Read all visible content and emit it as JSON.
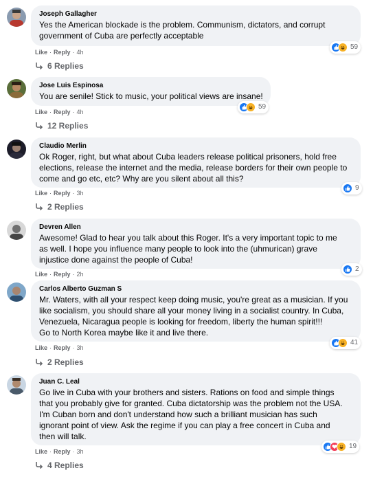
{
  "actions": {
    "like": "Like",
    "reply": "Reply",
    "separator": "·"
  },
  "colors": {
    "like": "#1877f2",
    "haha": "#f7b125",
    "love": "#f33e58",
    "secondary_text": "#65676b",
    "bubble": "#f0f2f5"
  },
  "comments": [
    {
      "author": "Joseph Gallagher",
      "text": [
        "Yes the American blockade is the problem. Communism, dictators, and corrupt",
        "government of Cuba are perfectly acceptable"
      ],
      "time": "4h",
      "reactions": {
        "icons": [
          "like-icon",
          "haha-icon"
        ],
        "count": "59"
      },
      "replies": "6 Replies"
    },
    {
      "author": "Jose Luis Espinosa",
      "text": [
        "You are senile! Stick to music, your political views are insane!"
      ],
      "time": "4h",
      "reactions": {
        "icons": [
          "like-icon",
          "haha-icon"
        ],
        "count": "59"
      },
      "replies": "12 Replies"
    },
    {
      "author": "Claudio Merlin",
      "text": [
        "Ok Roger, right, but what about Cuba leaders release political prisoners, hold free",
        "elections, release the internet and the media, release borders for their own people to",
        "come and go etc, etc? Why are you silent about all this?"
      ],
      "time": "3h",
      "reactions": {
        "icons": [
          "like-icon"
        ],
        "count": "9"
      },
      "replies": "2 Replies"
    },
    {
      "author": "Devren Allen",
      "text": [
        "Awesome! Glad to hear you talk about this Roger. It's a very important topic to me",
        "as well. I hope you influence many people to look into the (uhmurican) grave",
        "injustice done against the people of Cuba!"
      ],
      "time": "2h",
      "reactions": {
        "icons": [
          "like-icon"
        ],
        "count": "2"
      },
      "replies": ""
    },
    {
      "author": "Carlos Alberto Guzman S",
      "text": [
        "Mr. Waters, with all your respect keep doing music, you're great as a musician. If you",
        "like socialism, you should share all your money living in a socialist country. In Cuba,",
        "Venezuela, Nicaragua people is looking for freedom, liberty the human spirit!!!",
        "Go to North Korea maybe like it and live there."
      ],
      "time": "3h",
      "reactions": {
        "icons": [
          "like-icon",
          "haha-icon"
        ],
        "count": "41"
      },
      "replies": "2 Replies"
    },
    {
      "author": "Juan C. Leal",
      "text": [
        "Go live in Cuba with your brothers and sisters. Rations on food and simple things",
        "that you probably give for granted. Cuba dictatorship was the problem not the USA.",
        "I'm Cuban born and don't understand how such a brilliant musician has such",
        "ignorant point of view. Ask the regime if you can play a free concert in Cuba and",
        "then will talk."
      ],
      "time": "3h",
      "reactions": {
        "icons": [
          "like-icon",
          "love-icon",
          "haha-icon"
        ],
        "count": "19"
      },
      "replies": "4 Replies"
    }
  ]
}
